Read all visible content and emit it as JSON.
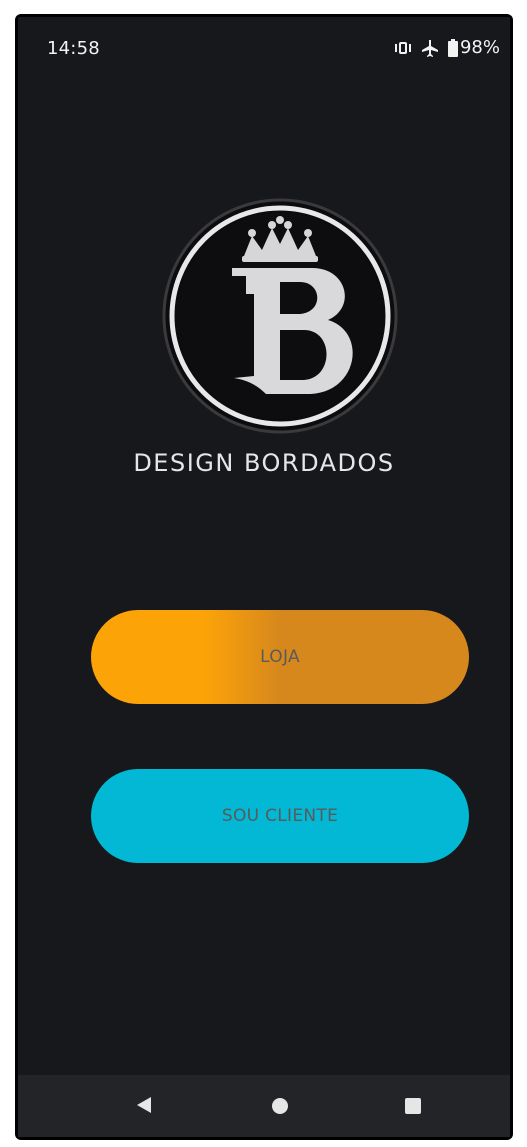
{
  "status_bar": {
    "time": "14:58",
    "battery": "98%",
    "icons": [
      "vibrate-icon",
      "airplane-icon",
      "battery-icon"
    ]
  },
  "brand": {
    "logo_icon": "crown-b-logo",
    "name": "DESIGN BORDADOS"
  },
  "buttons": {
    "loja_label": "LOJA",
    "cliente_label": "SOU CLIENTE"
  },
  "nav": {
    "icons": [
      "back-icon",
      "home-icon",
      "recents-icon"
    ]
  },
  "colors": {
    "background": "#17181c",
    "loja_orange": "#fca308",
    "loja_dark_orange": "#d6881d",
    "cliente_cyan": "#02b8d4",
    "button_text": "#5a5a5a"
  }
}
